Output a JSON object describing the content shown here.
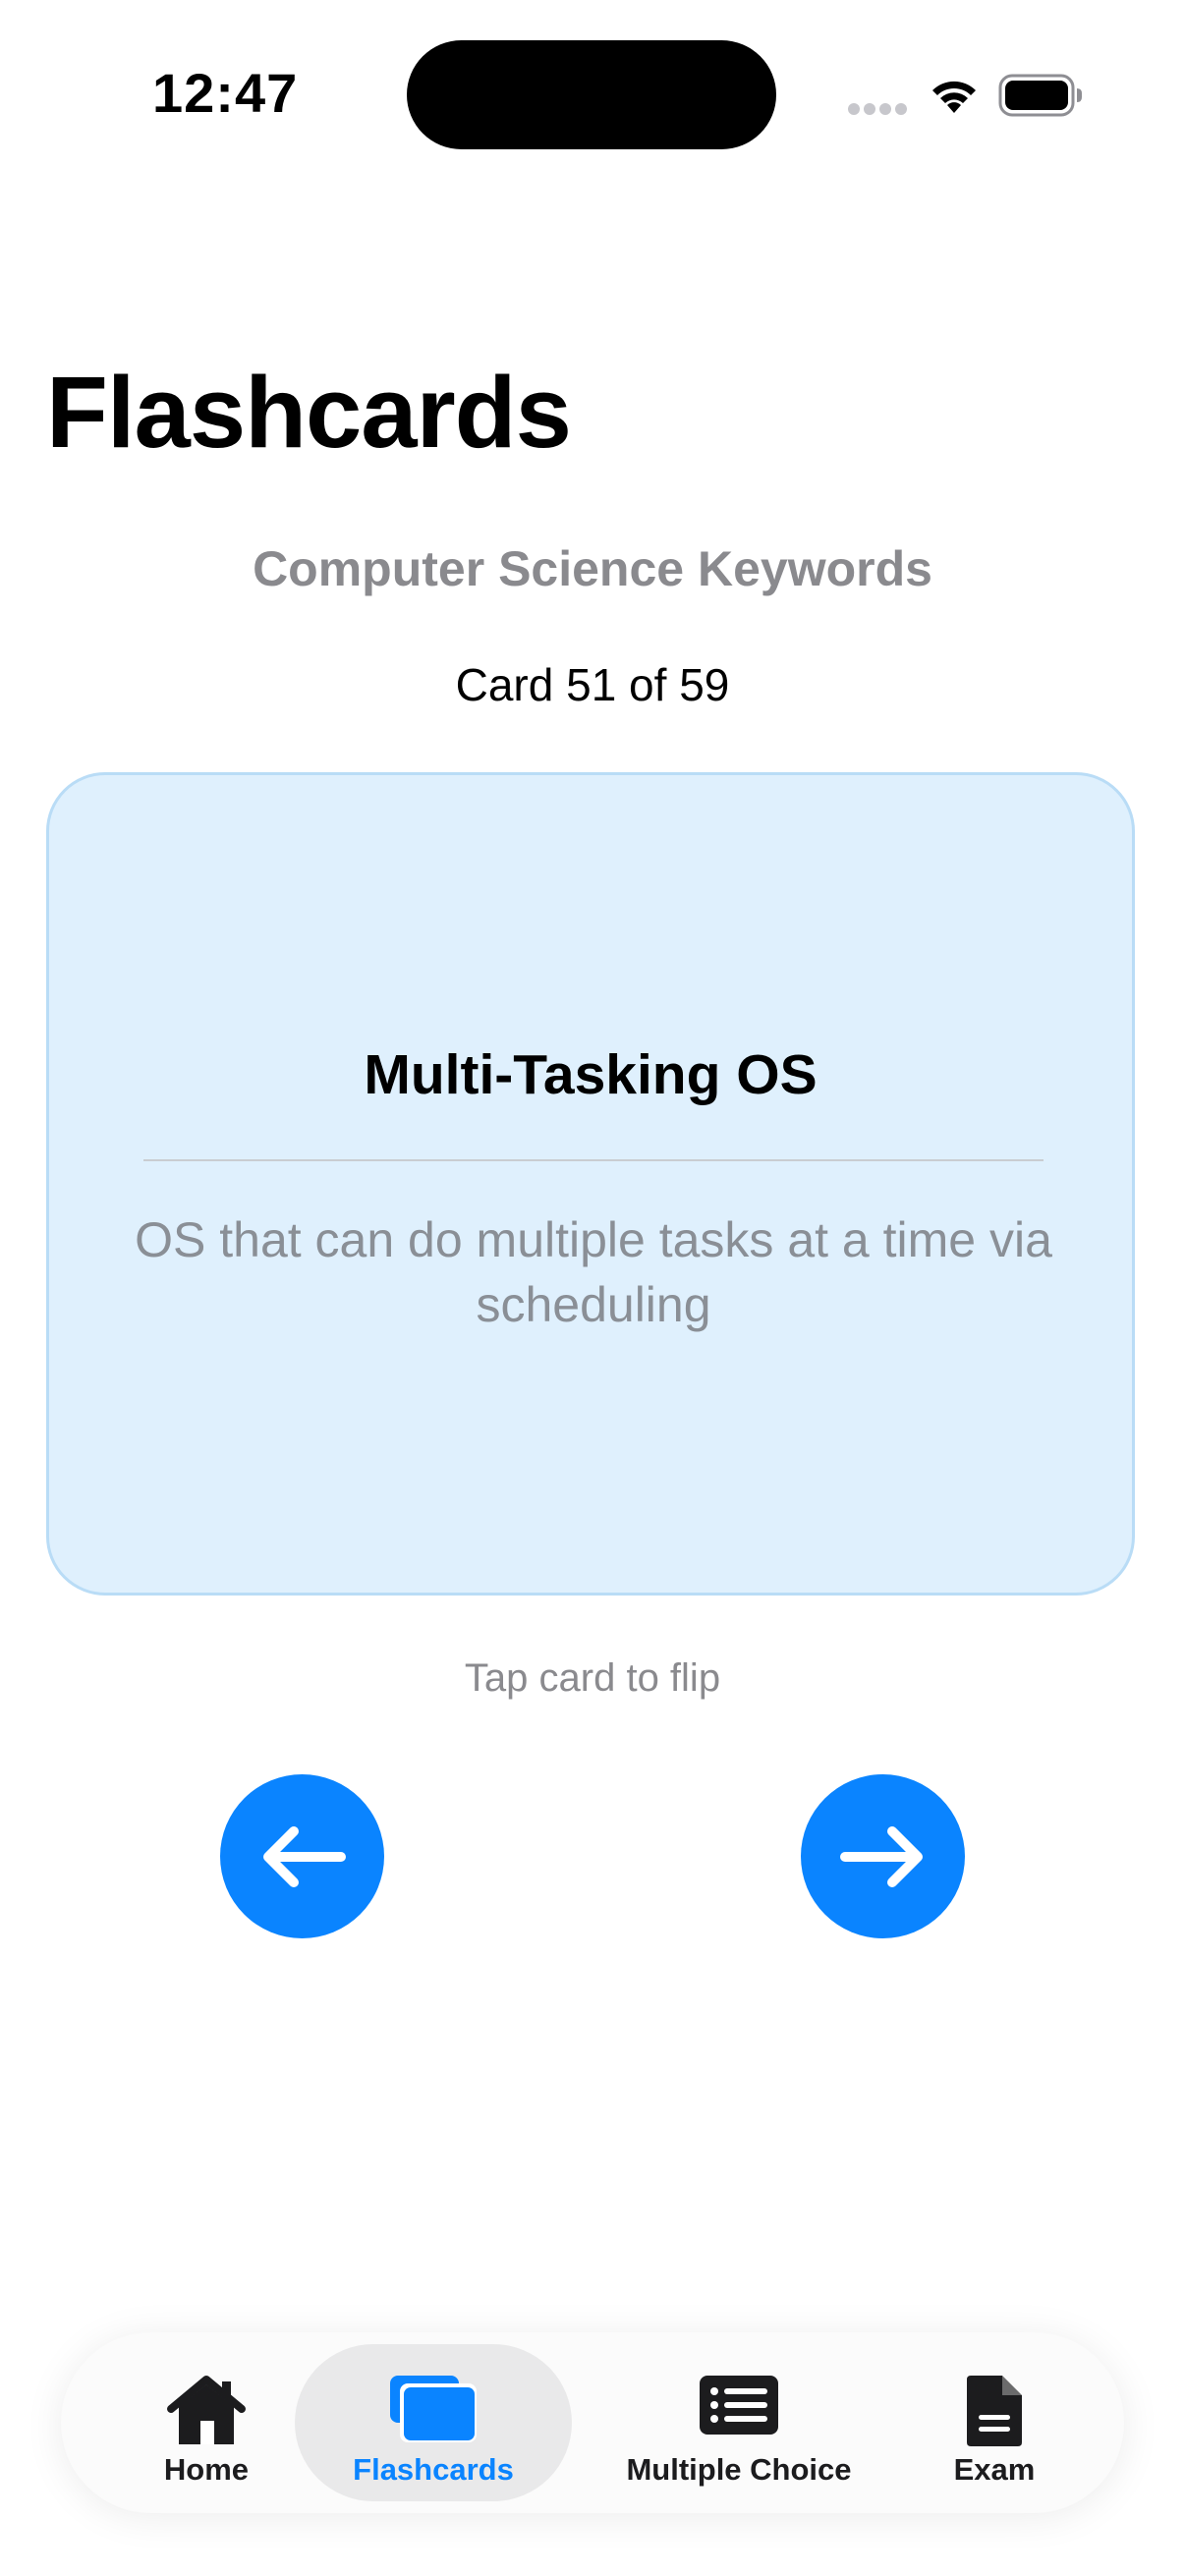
{
  "status_bar": {
    "time": "12:47"
  },
  "header": {
    "title": "Flashcards",
    "deck_name": "Computer Science Keywords",
    "counter": "Card 51 of 59"
  },
  "card": {
    "term": "Multi-Tasking OS",
    "definition": "OS that can do multiple tasks at a time via scheduling",
    "hint": "Tap card to flip"
  },
  "navigation": {
    "prev_icon": "arrow-left-icon",
    "next_icon": "arrow-right-icon"
  },
  "tab_bar": {
    "selected": "Flashcards",
    "tabs": [
      {
        "label": "Home",
        "icon": "house-icon"
      },
      {
        "label": "Flashcards",
        "icon": "cards-icon"
      },
      {
        "label": "Multiple Choice",
        "icon": "list-icon"
      },
      {
        "label": "Exam",
        "icon": "document-icon"
      }
    ]
  },
  "colors": {
    "accent": "#0a84ff",
    "card_background": "#dff0fd",
    "card_border": "#b9dcf6",
    "secondary_text": "#8a8a8e"
  }
}
